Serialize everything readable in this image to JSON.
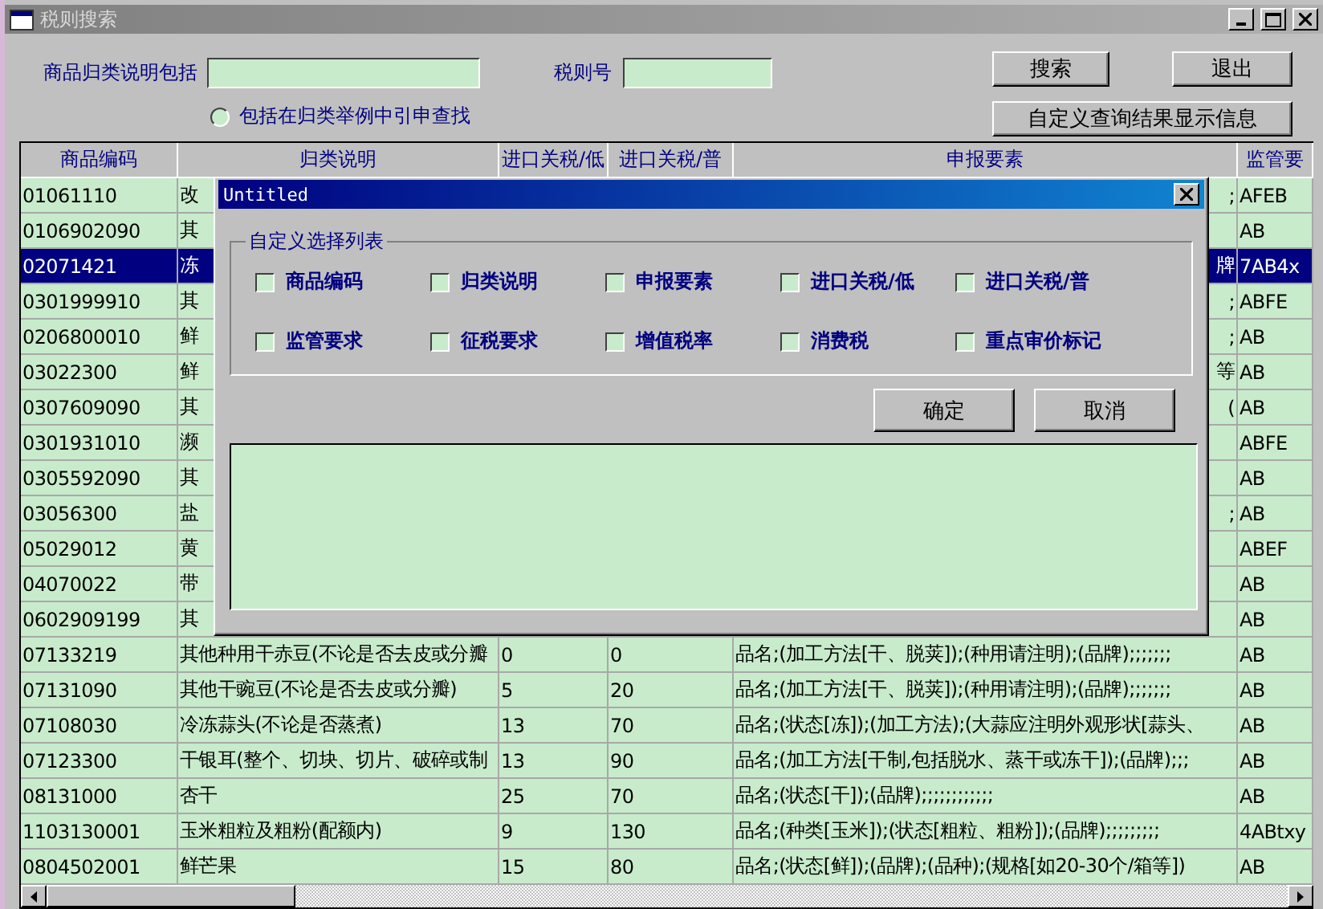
{
  "window": {
    "title": "税则搜索"
  },
  "form": {
    "desc_label": "商品归类说明包括",
    "code_label": "税则号",
    "radio": {
      "label": "包括在归类举例中引申查找",
      "selected": false
    },
    "buttons": {
      "search": "搜索",
      "exit": "退出",
      "custom": "自定义查询结果显示信息"
    }
  },
  "table": {
    "columns": [
      "商品编码",
      "归类说明",
      "进口关税/低",
      "进口关税/普",
      "申报要素",
      "监管要"
    ],
    "rows": [
      {
        "code": "01061110",
        "desc": "改",
        "low": "",
        "gen": "",
        "elements": ";",
        "sup": "AFEB",
        "selected": false
      },
      {
        "code": "0106902090",
        "desc": "其",
        "low": "",
        "gen": "",
        "elements": "",
        "sup": "AB",
        "selected": false
      },
      {
        "code": "02071421",
        "desc": "冻",
        "low": "",
        "gen": "",
        "elements": "牌",
        "sup": "7AB4x",
        "selected": true
      },
      {
        "code": "0301999910",
        "desc": "其",
        "low": "",
        "gen": "",
        "elements": ";",
        "sup": "ABFE",
        "selected": false
      },
      {
        "code": "0206800010",
        "desc": "鲜",
        "low": "",
        "gen": "",
        "elements": ";",
        "sup": "AB",
        "selected": false
      },
      {
        "code": "03022300",
        "desc": "鲜",
        "low": "",
        "gen": "",
        "elements": "等",
        "sup": "AB",
        "selected": false
      },
      {
        "code": "0307609090",
        "desc": "其",
        "low": "",
        "gen": "",
        "elements": "(",
        "sup": "AB",
        "selected": false
      },
      {
        "code": "0301931010",
        "desc": "濒",
        "low": "",
        "gen": "",
        "elements": "",
        "sup": "ABFE",
        "selected": false
      },
      {
        "code": "0305592090",
        "desc": "其",
        "low": "",
        "gen": "",
        "elements": "",
        "sup": "AB",
        "selected": false
      },
      {
        "code": "03056300",
        "desc": "盐",
        "low": "",
        "gen": "",
        "elements": ";",
        "sup": "AB",
        "selected": false
      },
      {
        "code": "05029012",
        "desc": "黄",
        "low": "",
        "gen": "",
        "elements": "",
        "sup": "ABEF",
        "selected": false
      },
      {
        "code": "04070022",
        "desc": "带",
        "low": "",
        "gen": "",
        "elements": "",
        "sup": "AB",
        "selected": false
      },
      {
        "code": "0602909199",
        "desc": "其",
        "low": "",
        "gen": "",
        "elements": "",
        "sup": "AB",
        "selected": false
      },
      {
        "code": "07133219",
        "desc": "其他种用干赤豆(不论是否去皮或分瓣",
        "low": "0",
        "gen": "0",
        "elements": "品名;(加工方法[干、脱荚]);(种用请注明);(品牌);;;;;;;",
        "sup": "AB",
        "selected": false
      },
      {
        "code": "07131090",
        "desc": "其他干豌豆(不论是否去皮或分瓣)",
        "low": "5",
        "gen": "20",
        "elements": "品名;(加工方法[干、脱荚]);(种用请注明);(品牌);;;;;;;",
        "sup": "AB",
        "selected": false
      },
      {
        "code": "07108030",
        "desc": "冷冻蒜头(不论是否蒸煮)",
        "low": "13",
        "gen": "70",
        "elements": "品名;(状态[冻]);(加工方法);(大蒜应注明外观形状[蒜头、",
        "sup": "AB",
        "selected": false
      },
      {
        "code": "07123300",
        "desc": "干银耳(整个、切块、切片、破碎或制",
        "low": "13",
        "gen": "90",
        "elements": "品名;(加工方法[干制,包括脱水、蒸干或冻干]);(品牌);;;",
        "sup": "AB",
        "selected": false
      },
      {
        "code": "08131000",
        "desc": "杏干",
        "low": "25",
        "gen": "70",
        "elements": "品名;(状态[干]);(品牌);;;;;;;;;;;;",
        "sup": "AB",
        "selected": false
      },
      {
        "code": "1103130001",
        "desc": "玉米粗粒及粗粉(配额内)",
        "low": "9",
        "gen": "130",
        "elements": "品名;(种类[玉米]);(状态[粗粒、粗粉]);(品牌);;;;;;;;;",
        "sup": "4ABtxy",
        "selected": false
      },
      {
        "code": "0804502001",
        "desc": "鲜芒果",
        "low": "15",
        "gen": "80",
        "elements": "品名;(状态[鲜]);(品牌);(品种);(规格[如20-30个/箱等])",
        "sup": "AB",
        "selected": false
      }
    ]
  },
  "dialog": {
    "title": "Untitled",
    "group_title": "自定义选择列表",
    "checkboxes": [
      {
        "label": "商品编码",
        "checked": false
      },
      {
        "label": "归类说明",
        "checked": false
      },
      {
        "label": "申报要素",
        "checked": false
      },
      {
        "label": "进口关税/低",
        "checked": false
      },
      {
        "label": "进口关税/普",
        "checked": false
      },
      {
        "label": "监管要求",
        "checked": false
      },
      {
        "label": "征税要求",
        "checked": false
      },
      {
        "label": "增值税率",
        "checked": false
      },
      {
        "label": "消费税",
        "checked": false
      },
      {
        "label": "重点审价标记",
        "checked": false
      }
    ],
    "ok": "确定",
    "cancel": "取消"
  }
}
